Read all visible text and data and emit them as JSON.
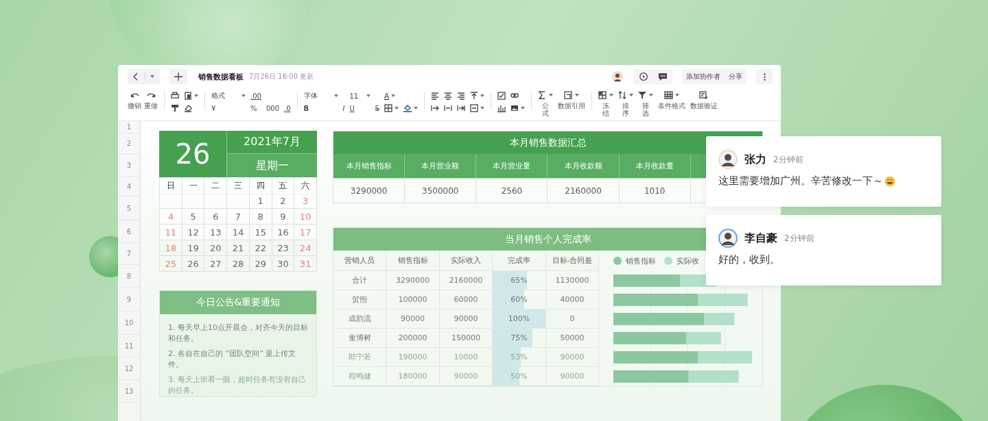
{
  "header": {
    "title": "销售数据看板",
    "updated": "7月26日 16:00 更新",
    "buttons": [
      "添加协作者",
      "分享"
    ]
  },
  "toolbar": {
    "undo": "撤销",
    "redo": "重做",
    "format": "格式",
    "decimal_more": ".00",
    "currency": "¥",
    "percent": "%",
    "thousands": "000",
    "decimal_less": ".0",
    "font": "字体",
    "font_size": "11",
    "font_color": "A",
    "bold": "B",
    "italic": "I",
    "underline": "U",
    "strike": "S",
    "formula": "公式",
    "data_reference": "数据引用",
    "freeze": "冻结",
    "sort": "排序",
    "filter": "筛选",
    "conditional_format": "条件格式",
    "validation": "数据验证"
  },
  "row_numbers": [
    "1",
    "2",
    "3",
    "4",
    "5",
    "6",
    "7",
    "8",
    "9",
    "10",
    "11",
    "12",
    "13"
  ],
  "calendar": {
    "day": "26",
    "month": "2021年7月",
    "weekday": "星期一",
    "weekday_headers": [
      "日",
      "一",
      "二",
      "三",
      "四",
      "五",
      "六"
    ],
    "weeks": [
      [
        "1",
        "2",
        "3"
      ],
      [
        "4",
        "5",
        "6",
        "7",
        "8",
        "9",
        "10"
      ],
      [
        "11",
        "12",
        "13",
        "14",
        "15",
        "16",
        "17"
      ],
      [
        "18",
        "19",
        "20",
        "21",
        "22",
        "23",
        "24"
      ],
      [
        "25",
        "26",
        "27",
        "28",
        "29",
        "30",
        "31"
      ]
    ]
  },
  "notice": {
    "title": "今日公告&重要通知",
    "items": [
      "1. 每天早上10点开晨会，对齐今天的目标和任务。",
      "2. 各自在自己的 “团队空间” 里上传文件。",
      "3. 每天上班看一眼，超时任务有没有自己的任务。"
    ]
  },
  "summary": {
    "title": "本月销售数据汇总",
    "columns": [
      "本月销售指标",
      "本月营业额",
      "本月营业量",
      "本月收款额",
      "本月收款量"
    ],
    "values": [
      "3290000",
      "3500000",
      "2560",
      "2160000",
      "1010"
    ]
  },
  "sales": {
    "title": "当月销售个人完成率",
    "columns": [
      "营销人员",
      "销售指标",
      "实际收入",
      "完成率",
      "目标-合同差"
    ],
    "legend": [
      {
        "label": "销售指标",
        "color": "#8cc7a0"
      },
      {
        "label": "实际收",
        "color": "#b2e0c8"
      }
    ],
    "rows": [
      {
        "cells": [
          "合计",
          "3290000",
          "2160000",
          "65%",
          "1130000"
        ],
        "level": 0.65
      },
      {
        "cells": [
          "贺煦",
          "100000",
          "60000",
          "60%",
          "40000"
        ],
        "level": 0.6
      },
      {
        "cells": [
          "成韵流",
          "90000",
          "90000",
          "100%",
          "0"
        ],
        "level": 1
      },
      {
        "cells": [
          "童博树",
          "200000",
          "150000",
          "75%",
          "50000"
        ],
        "level": 0.75
      },
      {
        "cells": [
          "郎宁若",
          "190000",
          "10000",
          "53%",
          "90000"
        ],
        "level": 0.53
      },
      {
        "cells": [
          "程鸣健",
          "180000",
          "90000",
          "50%",
          "90000"
        ],
        "level": 0.5
      }
    ]
  },
  "comments": [
    {
      "name": "张力",
      "time": "2分钟前",
      "text": "这里需要增加广州。辛苦修改一下～",
      "emoji": true
    },
    {
      "name": "李自豪",
      "time": "2分钟前",
      "text": "好的，收到。",
      "emoji": false
    }
  ]
}
